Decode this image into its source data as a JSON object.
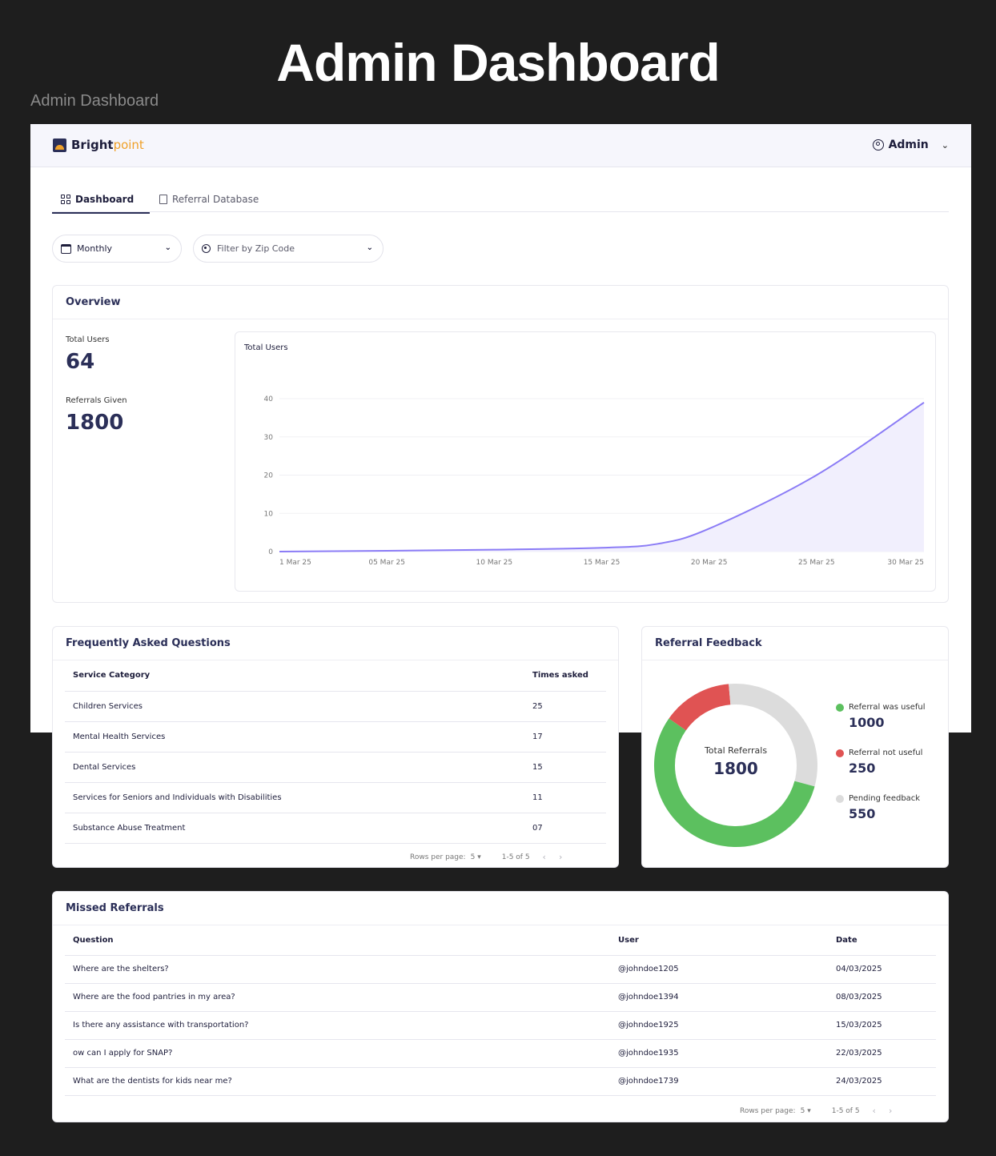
{
  "page": {
    "heading": "Admin Dashboard",
    "frame_label": "Admin Dashboard"
  },
  "header": {
    "logo_bold": "Bright",
    "logo_light": "point",
    "admin_label": "Admin"
  },
  "tabs": [
    {
      "label": "Dashboard",
      "active": true,
      "icon": "grid-icon"
    },
    {
      "label": "Referral Database",
      "active": false,
      "icon": "document-icon"
    }
  ],
  "filters": {
    "period": "Monthly",
    "zip_placeholder": "Filter by Zip Code"
  },
  "overview": {
    "title": "Overview",
    "stats": [
      {
        "label": "Total Users",
        "value": "64"
      },
      {
        "label": "Referrals Given",
        "value": "1800"
      }
    ]
  },
  "chart_data": {
    "type": "area",
    "title": "Total Users",
    "xlabel": "",
    "ylabel": "",
    "ylim": [
      0,
      40
    ],
    "yticks": [
      0,
      10,
      20,
      30,
      40
    ],
    "xticks": [
      "1 Mar 25",
      "05 Mar 25",
      "10 Mar 25",
      "15 Mar 25",
      "20 Mar 25",
      "25 Mar 25",
      "30 Mar 25"
    ],
    "grid": true,
    "color": "#8b7cf6",
    "series": [
      {
        "x": [
          "1 Mar 25",
          "05 Mar 25",
          "10 Mar 25",
          "15 Mar 25",
          "18 Mar 25",
          "20 Mar 25",
          "25 Mar 25",
          "30 Mar 25"
        ],
        "values": [
          0,
          0.2,
          0.5,
          1,
          2,
          6,
          20,
          39
        ]
      }
    ]
  },
  "faq": {
    "title": "Frequently Asked Questions",
    "columns": [
      "Service Category",
      "Times asked"
    ],
    "rows": [
      [
        "Children Services",
        "25"
      ],
      [
        "Mental Health Services",
        "17"
      ],
      [
        "Dental Services",
        "15"
      ],
      [
        "Services for Seniors and Individuals with Disabilities",
        "11"
      ],
      [
        "Substance Abuse Treatment",
        "07"
      ]
    ],
    "rows_per_page_label": "Rows per page:",
    "rows_per_page": "5",
    "range": "1-5 of 5"
  },
  "feedback": {
    "title": "Referral Feedback",
    "center_label": "Total Referrals",
    "center_value": "1800",
    "items": [
      {
        "label": "Referral was useful",
        "value": "1000",
        "color": "#5cc05f"
      },
      {
        "label": "Referral not useful",
        "value": "250",
        "color": "#e05353"
      },
      {
        "label": "Pending feedback",
        "value": "550",
        "color": "#dcdcdc"
      }
    ]
  },
  "missed": {
    "title": "Missed Referrals",
    "columns": [
      "Question",
      "User",
      "Date"
    ],
    "rows": [
      [
        "Where are the shelters?",
        "@johndoe1205",
        "04/03/2025"
      ],
      [
        "Where are the food pantries in my area?",
        "@johndoe1394",
        "08/03/2025"
      ],
      [
        "Is there any assistance with transportation?",
        "@johndoe1925",
        "15/03/2025"
      ],
      [
        "ow can I apply for SNAP?",
        "@johndoe1935",
        "22/03/2025"
      ],
      [
        "What are the dentists for kids near me?",
        "@johndoe1739",
        "24/03/2025"
      ]
    ],
    "rows_per_page_label": "Rows per page:",
    "rows_per_page": "5",
    "range": "1-5 of 5"
  }
}
